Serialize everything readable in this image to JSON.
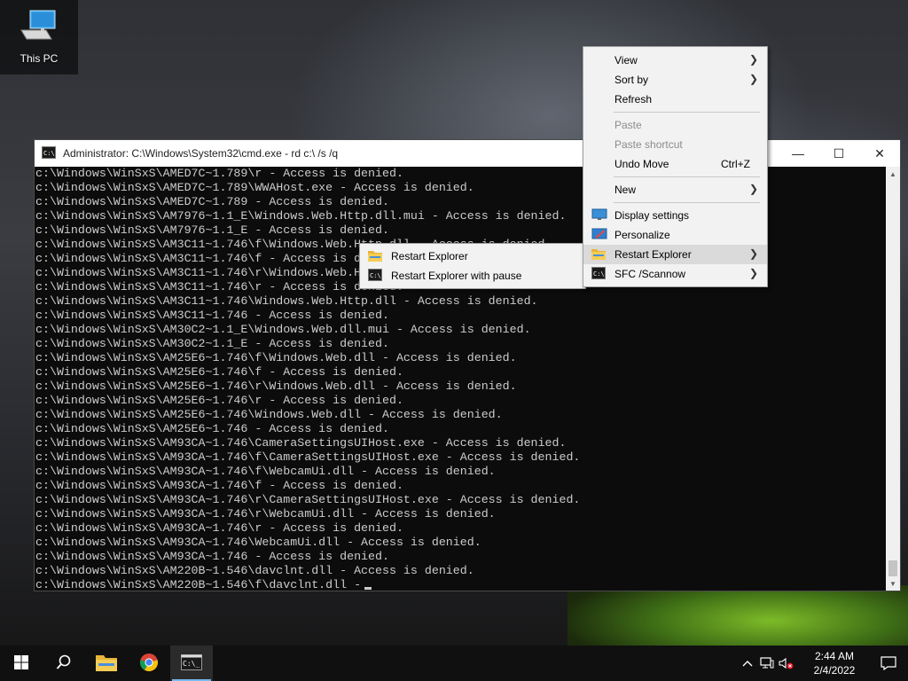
{
  "desktop": {
    "icons": [
      {
        "label": "This PC"
      }
    ]
  },
  "cmd_window": {
    "title": "Administrator: C:\\Windows\\System32\\cmd.exe - rd  c:\\ /s /q",
    "lines": [
      "c:\\Windows\\WinSxS\\AMED7C~1.789\\r - Access is denied.",
      "c:\\Windows\\WinSxS\\AMED7C~1.789\\WWAHost.exe - Access is denied.",
      "c:\\Windows\\WinSxS\\AMED7C~1.789 - Access is denied.",
      "c:\\Windows\\WinSxS\\AM7976~1.1_E\\Windows.Web.Http.dll.mui - Access is denied.",
      "c:\\Windows\\WinSxS\\AM7976~1.1_E - Access is denied.",
      "c:\\Windows\\WinSxS\\AM3C11~1.746\\f\\Windows.Web.Http.dll - Access is denied.",
      "c:\\Windows\\WinSxS\\AM3C11~1.746\\f - Access is denied.",
      "c:\\Windows\\WinSxS\\AM3C11~1.746\\r\\Windows.Web.Http.dll - Access is denied.",
      "c:\\Windows\\WinSxS\\AM3C11~1.746\\r - Access is denied.",
      "c:\\Windows\\WinSxS\\AM3C11~1.746\\Windows.Web.Http.dll - Access is denied.",
      "c:\\Windows\\WinSxS\\AM3C11~1.746 - Access is denied.",
      "c:\\Windows\\WinSxS\\AM30C2~1.1_E\\Windows.Web.dll.mui - Access is denied.",
      "c:\\Windows\\WinSxS\\AM30C2~1.1_E - Access is denied.",
      "c:\\Windows\\WinSxS\\AM25E6~1.746\\f\\Windows.Web.dll - Access is denied.",
      "c:\\Windows\\WinSxS\\AM25E6~1.746\\f - Access is denied.",
      "c:\\Windows\\WinSxS\\AM25E6~1.746\\r\\Windows.Web.dll - Access is denied.",
      "c:\\Windows\\WinSxS\\AM25E6~1.746\\r - Access is denied.",
      "c:\\Windows\\WinSxS\\AM25E6~1.746\\Windows.Web.dll - Access is denied.",
      "c:\\Windows\\WinSxS\\AM25E6~1.746 - Access is denied.",
      "c:\\Windows\\WinSxS\\AM93CA~1.746\\CameraSettingsUIHost.exe - Access is denied.",
      "c:\\Windows\\WinSxS\\AM93CA~1.746\\f\\CameraSettingsUIHost.exe - Access is denied.",
      "c:\\Windows\\WinSxS\\AM93CA~1.746\\f\\WebcamUi.dll - Access is denied.",
      "c:\\Windows\\WinSxS\\AM93CA~1.746\\f - Access is denied.",
      "c:\\Windows\\WinSxS\\AM93CA~1.746\\r\\CameraSettingsUIHost.exe - Access is denied.",
      "c:\\Windows\\WinSxS\\AM93CA~1.746\\r\\WebcamUi.dll - Access is denied.",
      "c:\\Windows\\WinSxS\\AM93CA~1.746\\r - Access is denied.",
      "c:\\Windows\\WinSxS\\AM93CA~1.746\\WebcamUi.dll - Access is denied.",
      "c:\\Windows\\WinSxS\\AM93CA~1.746 - Access is denied.",
      "c:\\Windows\\WinSxS\\AM220B~1.546\\davclnt.dll - Access is denied.",
      "c:\\Windows\\WinSxS\\AM220B~1.546\\f\\davclnt.dll -"
    ]
  },
  "context_menu": {
    "view": "View",
    "sort_by": "Sort by",
    "refresh": "Refresh",
    "paste": "Paste",
    "paste_shortcut": "Paste shortcut",
    "undo_move": "Undo Move",
    "undo_shortcut": "Ctrl+Z",
    "new": "New",
    "display_settings": "Display settings",
    "personalize": "Personalize",
    "restart_explorer": "Restart Explorer",
    "sfc_scannow": "SFC /Scannow"
  },
  "submenu": {
    "restart_explorer": "Restart Explorer",
    "restart_explorer_pause": "Restart Explorer with pause"
  },
  "taskbar": {
    "clock_time": "2:44 AM",
    "clock_date": "2/4/2022"
  },
  "colors": {
    "console_text": "#cccccc",
    "console_bg": "#0c0c0c",
    "taskbar_bg": "#101010",
    "accent": "#76b9ed"
  }
}
